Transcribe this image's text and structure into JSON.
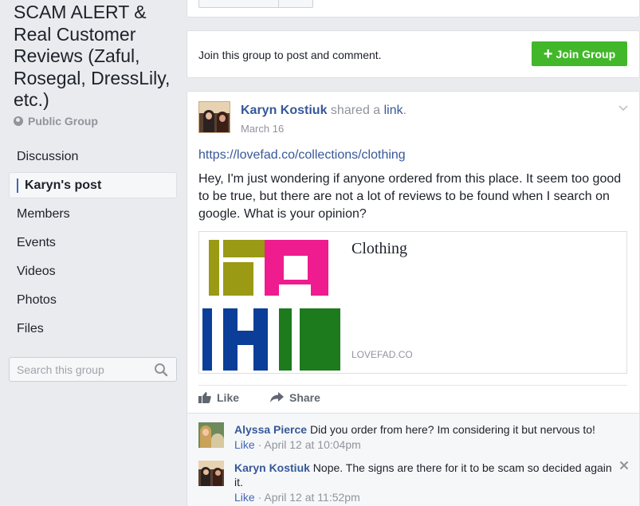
{
  "group": {
    "title": "SCAM ALERT & Real Customer Reviews (Zaful, Rosegal, DressLily, etc.)",
    "privacy": "Public Group"
  },
  "nav": {
    "items": [
      {
        "label": "Discussion"
      },
      {
        "label": "Karyn's post"
      },
      {
        "label": "Members"
      },
      {
        "label": "Events"
      },
      {
        "label": "Videos"
      },
      {
        "label": "Photos"
      },
      {
        "label": "Files"
      }
    ],
    "active_index": 1
  },
  "search": {
    "placeholder": "Search this group"
  },
  "join": {
    "prompt": "Join this group to post and comment.",
    "button_label": "Join Group",
    "button_icon": "plus-icon",
    "button_color": "#42b72a"
  },
  "post": {
    "author": "Karyn Kostiuk",
    "action_prefix": " shared a ",
    "action_link": "link",
    "action_suffix": ".",
    "date": "March 16",
    "url": "https://lovefad.co/collections/clothing",
    "body": "Hey, I'm just wondering if anyone ordered from this place. It seem too good to be true, but there are not a lot of reviews to be found when I search on google. What is your opinion?",
    "link_preview": {
      "title": "Clothing",
      "domain": "LOVEFAD.CO"
    },
    "actions": {
      "like": "Like",
      "share": "Share"
    }
  },
  "comments": [
    {
      "author": "Alyssa Pierce",
      "text": " Did you order from here? Im considering it but nervous to!",
      "like": "Like",
      "separator": " · ",
      "time": "April 12 at 10:04pm"
    },
    {
      "author": "Karyn Kostiuk",
      "text": " Nope. The signs are there for it to be scam so decided again it.",
      "like": "Like",
      "separator": " · ",
      "time": "April 12 at 11:52pm"
    }
  ],
  "colors": {
    "link_blue": "#365899",
    "muted_gray": "#90949c",
    "page_bg": "#e9ebee",
    "thumb_olive": "#9a9a14",
    "thumb_pink": "#ee1c8e",
    "thumb_navy": "#0b3e99",
    "thumb_green": "#1d7a1d"
  }
}
